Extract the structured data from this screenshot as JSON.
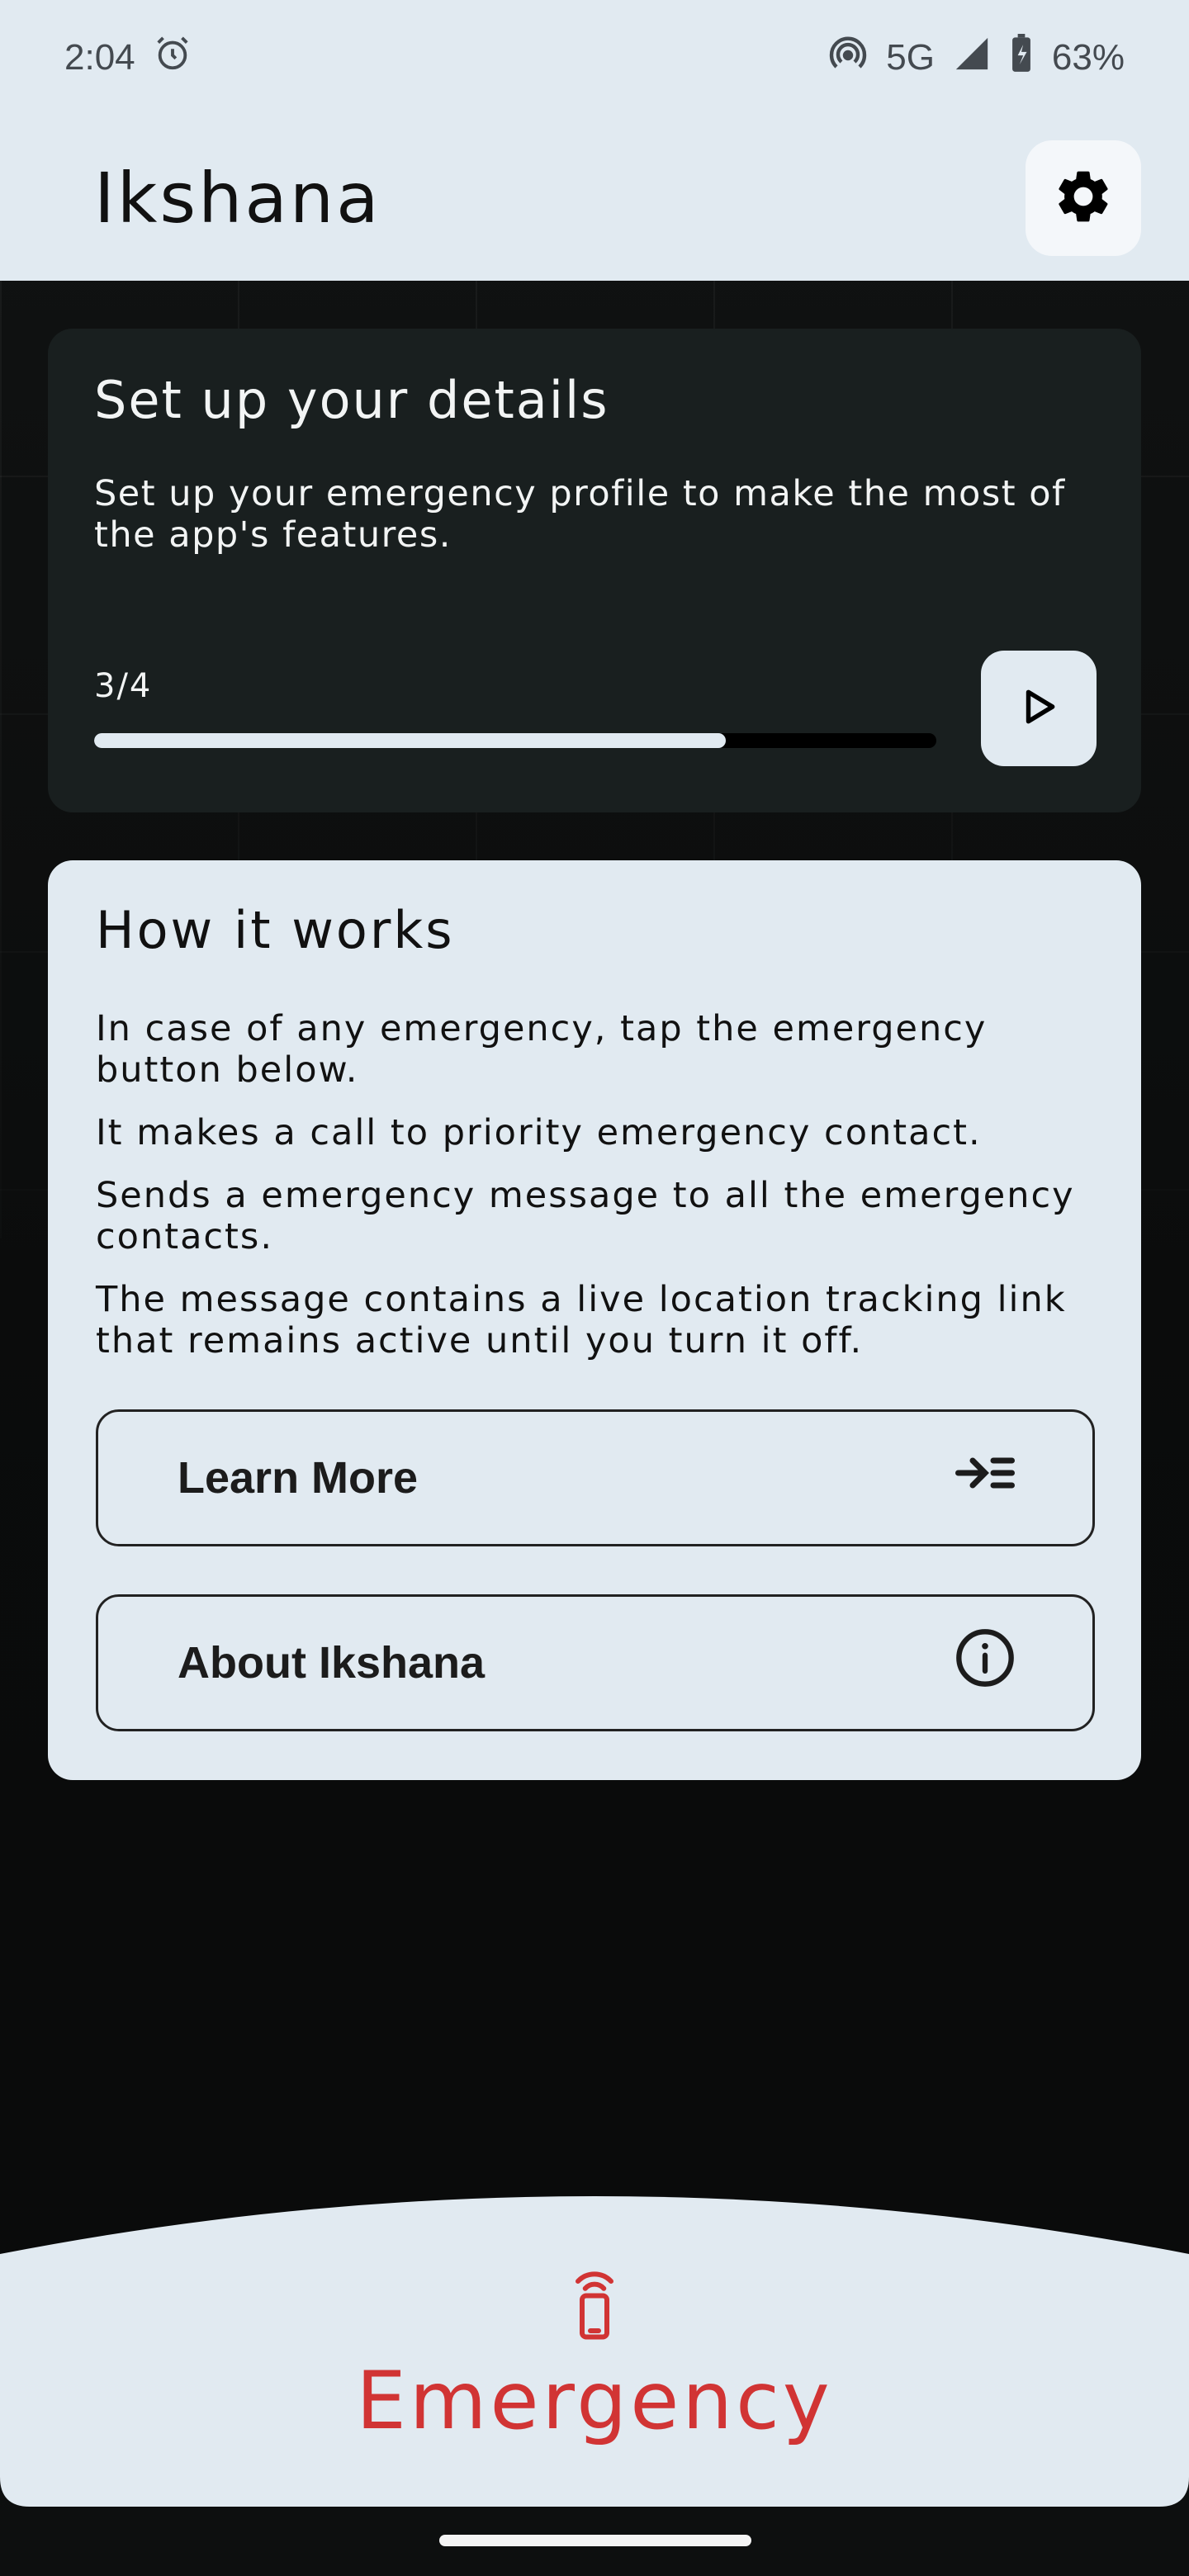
{
  "status_bar": {
    "time": "2:04",
    "network": "5G",
    "battery": "63%"
  },
  "app_bar": {
    "title": "Ikshana"
  },
  "setup_card": {
    "title": "Set up your details",
    "description": "Set up your emergency profile to make the most of the app's features.",
    "progress_label": "3/4",
    "progress_fraction": 0.75
  },
  "how_card": {
    "title": "How it works",
    "lines": [
      "In case of any emergency, tap the emergency button below.",
      "It makes a call to priority emergency contact.",
      "Sends a emergency message to all the emergency contacts.",
      "The message contains a live location tracking link that remains active until you turn it off."
    ],
    "learn_more_label": "Learn More",
    "about_label": "About Ikshana"
  },
  "emergency": {
    "label": "Emergency",
    "color": "#d13434"
  },
  "colors": {
    "surface": "#e1eaf1",
    "dark_card": "#191f1f",
    "background": "#0d0f0f"
  }
}
